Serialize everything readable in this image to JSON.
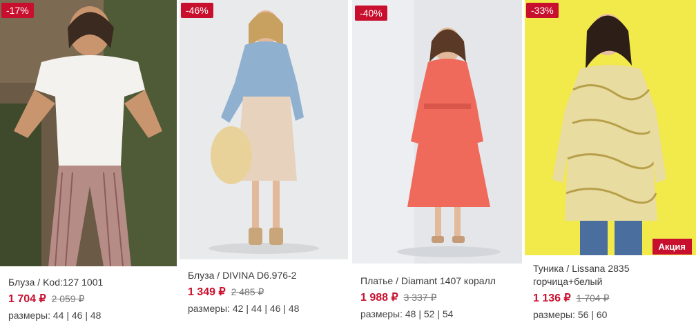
{
  "products": [
    {
      "discount": "-17%",
      "title": "Блуза / Kod:127 1001",
      "price": "1 704 ₽",
      "old_price": "2 059 ₽",
      "sizes_label": "размеры:",
      "sizes": "44 | 46 | 48"
    },
    {
      "discount": "-46%",
      "title": "Блуза / DIVINA D6.976-2",
      "price": "1 349 ₽",
      "old_price": "2 485 ₽",
      "sizes_label": "размеры:",
      "sizes": "42 | 44 | 46 | 48"
    },
    {
      "discount": "-40%",
      "title": "Платье / Diamant 1407 коралл",
      "price": "1 988 ₽",
      "old_price": "3 337 ₽",
      "sizes_label": "размеры:",
      "sizes": "48 | 52 | 54"
    },
    {
      "discount": "-33%",
      "promo": "Акция",
      "title": "Туника / Lissana 2835 горчица+белый",
      "price": "1 136 ₽",
      "old_price": "1 704 ₽",
      "sizes_label": "размеры:",
      "sizes": "56 | 60"
    }
  ]
}
